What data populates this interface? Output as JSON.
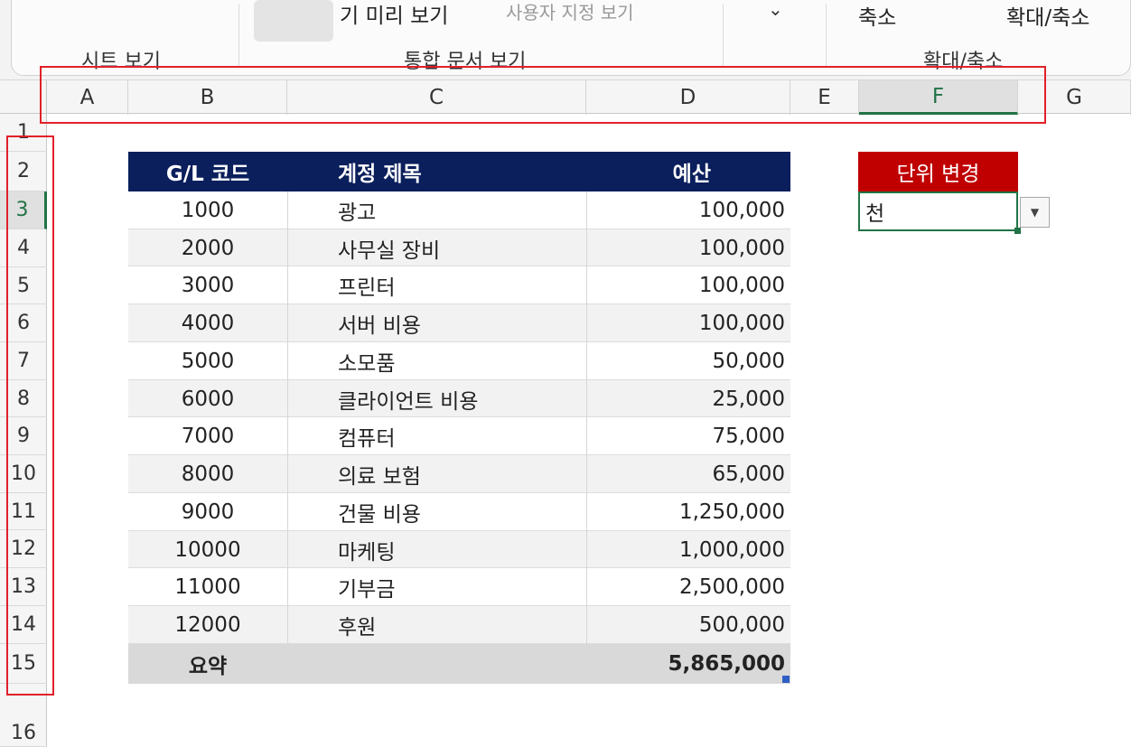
{
  "ribbon": {
    "preview_label": "기 미리 보기",
    "page_layout_label": "사용자 지정 보기",
    "zoom_label": "축소",
    "zoom_fit_label": "확대/축소",
    "groups": [
      "시트 보기",
      "통합 문서 보기",
      "확대/축소"
    ]
  },
  "columns": [
    "A",
    "B",
    "C",
    "D",
    "E",
    "F",
    "G"
  ],
  "selected_column": "F",
  "rows": [
    "1",
    "2",
    "3",
    "4",
    "5",
    "6",
    "7",
    "8",
    "9",
    "10",
    "11",
    "12",
    "13",
    "14",
    "15",
    "16"
  ],
  "selected_row": "3",
  "table": {
    "headers": {
      "code": "G/L 코드",
      "title": "계정 제목",
      "budget": "예산"
    },
    "rows": [
      {
        "code": "1000",
        "title": "광고",
        "budget": "100,000"
      },
      {
        "code": "2000",
        "title": "사무실 장비",
        "budget": "100,000"
      },
      {
        "code": "3000",
        "title": "프린터",
        "budget": "100,000"
      },
      {
        "code": "4000",
        "title": "서버 비용",
        "budget": "100,000"
      },
      {
        "code": "5000",
        "title": "소모품",
        "budget": "50,000"
      },
      {
        "code": "6000",
        "title": "클라이언트 비용",
        "budget": "25,000"
      },
      {
        "code": "7000",
        "title": "컴퓨터",
        "budget": "75,000"
      },
      {
        "code": "8000",
        "title": "의료 보험",
        "budget": "65,000"
      },
      {
        "code": "9000",
        "title": "건물 비용",
        "budget": "1,250,000"
      },
      {
        "code": "10000",
        "title": "마케팅",
        "budget": "1,000,000"
      },
      {
        "code": "11000",
        "title": "기부금",
        "budget": "2,500,000"
      },
      {
        "code": "12000",
        "title": "후원",
        "budget": "500,000"
      }
    ],
    "total_label": "요약",
    "total_value": "5,865,000"
  },
  "unit_selector": {
    "header": "단위 변경",
    "value": "천"
  },
  "colors": {
    "header_bg": "#0a1f5c",
    "unit_header_bg": "#c00000",
    "selection_green": "#217346",
    "annotation_red": "#e0202a"
  }
}
